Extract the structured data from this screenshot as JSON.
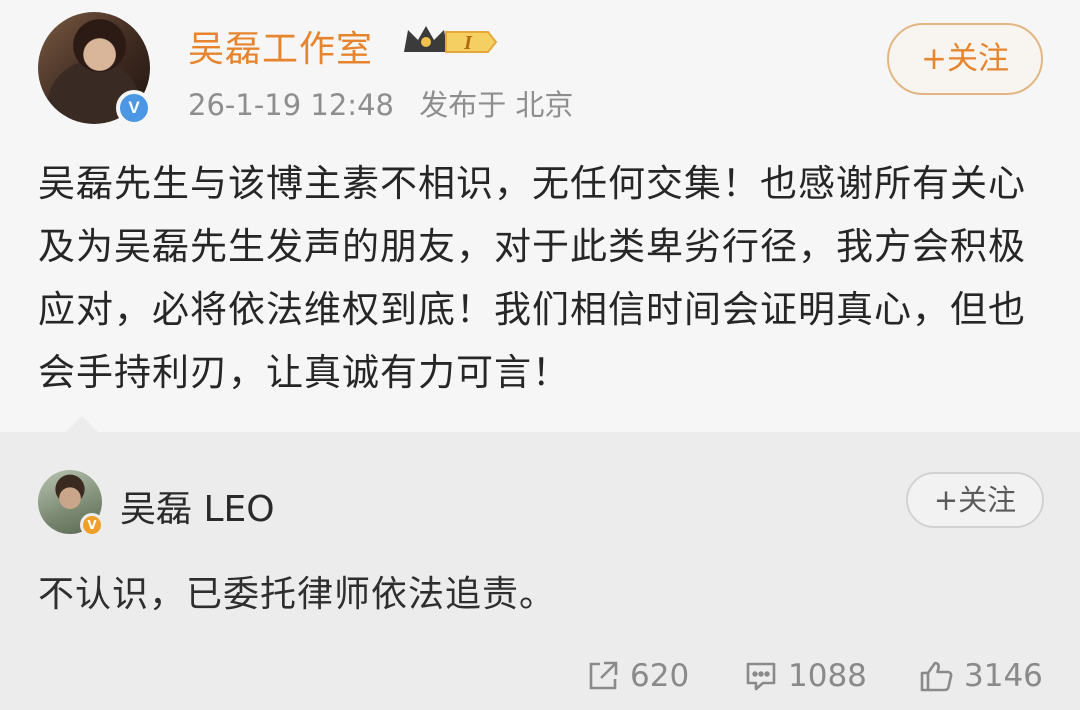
{
  "post": {
    "author_name": "吴磊工作室",
    "vip_level": "I",
    "timestamp": "26-1-19 12:48",
    "location_label": "发布于 北京",
    "follow_label": "+关注",
    "text": "吴磊先生与该博主素不相识，无任何交集！也感谢所有关心及为吴磊先生发声的朋友，对于此类卑劣行径，我方会积极应对，必将依法维权到底！我们相信时间会证明真心，但也会手持利刃，让真诚有力可言！"
  },
  "repost": {
    "author_name": "吴磊 LEO",
    "follow_label": "+关注",
    "text": "不认识，已委托律师依法追责。",
    "repost_count": "620",
    "comment_count": "1088",
    "like_count": "3146"
  },
  "icons": {
    "share": "share-icon",
    "comment": "comment-icon",
    "like": "like-icon",
    "verified": "verified-icon",
    "vip": "crown-badge-icon"
  },
  "colors": {
    "author_orange": "#e7852f",
    "verified_blue": "#4c97e3",
    "verified_orange": "#f0a02a",
    "text_gray": "#8e8e8e"
  }
}
